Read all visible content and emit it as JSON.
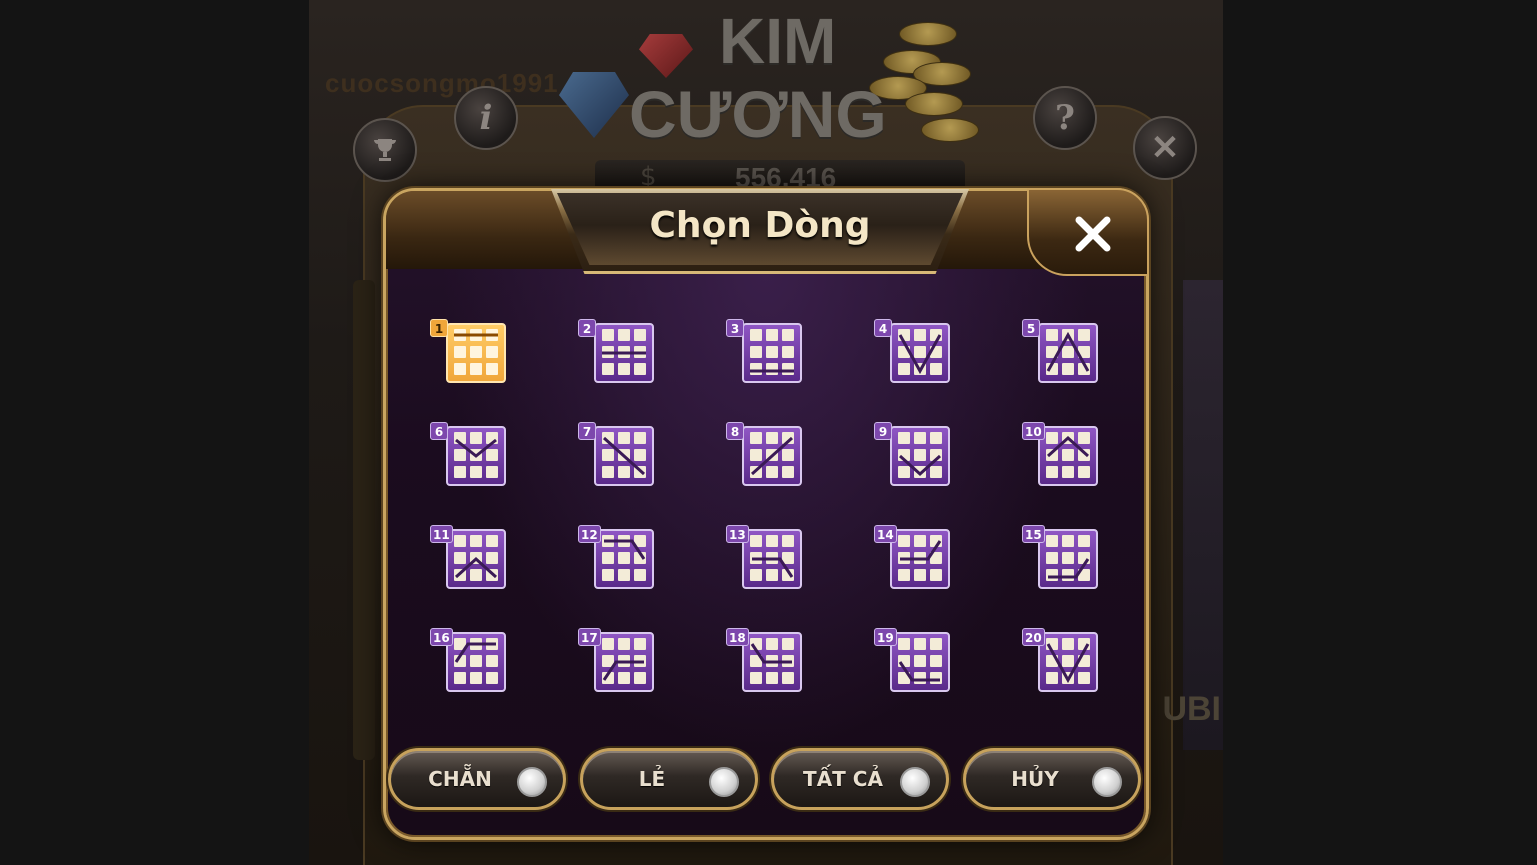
{
  "background": {
    "username": "cuocsongmo1991",
    "logo": {
      "line1": "KIM",
      "line2": "CƯƠNG"
    },
    "balance": {
      "currency_symbol": "$",
      "value": "556.416"
    },
    "side_text": "UBI",
    "icons": [
      "trophy-icon",
      "info-icon",
      "help-icon",
      "close-icon"
    ]
  },
  "dialog": {
    "title": "Chọn Dòng",
    "close_icon": "close-icon",
    "lines": [
      {
        "number": "1",
        "selected": true
      },
      {
        "number": "2",
        "selected": false
      },
      {
        "number": "3",
        "selected": false
      },
      {
        "number": "4",
        "selected": false
      },
      {
        "number": "5",
        "selected": false
      },
      {
        "number": "6",
        "selected": false
      },
      {
        "number": "7",
        "selected": false
      },
      {
        "number": "8",
        "selected": false
      },
      {
        "number": "9",
        "selected": false
      },
      {
        "number": "10",
        "selected": false
      },
      {
        "number": "11",
        "selected": false
      },
      {
        "number": "12",
        "selected": false
      },
      {
        "number": "13",
        "selected": false
      },
      {
        "number": "14",
        "selected": false
      },
      {
        "number": "15",
        "selected": false
      },
      {
        "number": "16",
        "selected": false
      },
      {
        "number": "17",
        "selected": false
      },
      {
        "number": "18",
        "selected": false
      },
      {
        "number": "19",
        "selected": false
      },
      {
        "number": "20",
        "selected": false
      }
    ],
    "buttons": {
      "even": "CHẴN",
      "odd": "LẺ",
      "all": "TẤT CẢ",
      "cancel": "HỦY"
    }
  },
  "colors": {
    "line_icon": "#7d48ad",
    "line_icon_selected": "#f0a63a",
    "gold_border": "#c9a560"
  }
}
